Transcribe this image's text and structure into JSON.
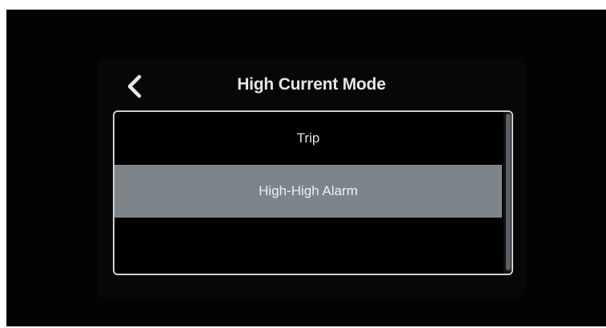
{
  "screen": {
    "title": "High Current Mode",
    "back_icon": "chevron-left-icon"
  },
  "options": [
    {
      "label": "Trip",
      "selected": false
    },
    {
      "label": "High-High Alarm",
      "selected": true
    },
    {
      "label": "",
      "selected": false
    }
  ],
  "colors": {
    "background": "#030303",
    "text": "#e6e6e6",
    "selected_row": "#7d858b",
    "panel_border": "#cfcfcf"
  }
}
